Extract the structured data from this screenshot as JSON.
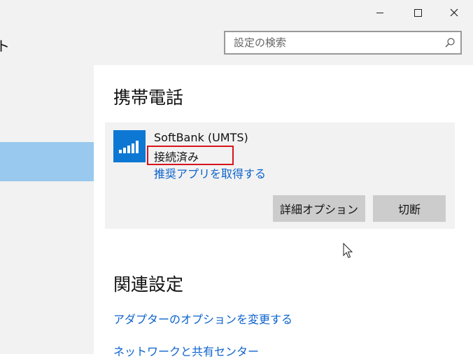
{
  "header": {
    "title_fragment": "ト",
    "search_placeholder": "設定の検索"
  },
  "window_controls": [
    {
      "name": "minimize-button",
      "icon": "minimize-icon"
    },
    {
      "name": "maximize-button",
      "icon": "maximize-icon"
    },
    {
      "name": "close-button",
      "icon": "close-icon"
    }
  ],
  "main": {
    "section_title": "携帯電話",
    "network": {
      "icon": "cellular-signal-icon",
      "name": "SoftBank (UMTS)",
      "status": "接続済み",
      "app_link": "推奨アプリを取得する",
      "advanced_button": "詳細オプション",
      "disconnect_button": "切断"
    },
    "related": {
      "title": "関連設定",
      "links": [
        "アダプターのオプションを変更する",
        "ネットワークと共有センター"
      ]
    }
  },
  "colors": {
    "accent": "#0c78d4",
    "link": "#0c63cc",
    "sidebar_selected": "#99c9ee",
    "highlight_box": "#d9141b"
  }
}
